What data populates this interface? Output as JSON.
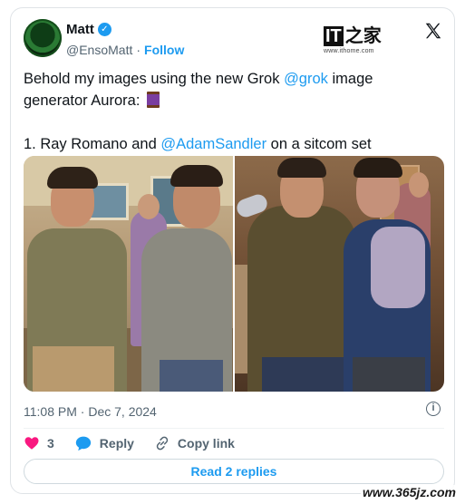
{
  "author": {
    "name": "Matt",
    "handle": "@EnsoMatt",
    "separator": "·",
    "follow_label": "Follow"
  },
  "ithome": {
    "logo_latin": "IT",
    "logo_chinese": "之家",
    "url": "www.ithome.com"
  },
  "tweet": {
    "line1_pre": "Behold my images using the new Grok ",
    "line1_mention": "@grok",
    "line1_post": " image generator Aurora: ",
    "line2_pre": "1. Ray Romano and ",
    "line2_mention": "@AdamSandler",
    "line2_post": " on a sitcom set"
  },
  "meta": {
    "time": "11:08 PM",
    "separator": "·",
    "date": "Dec 7, 2024"
  },
  "actions": {
    "likes": "3",
    "reply_label": "Reply",
    "copy_link_label": "Copy link"
  },
  "read_replies_label": "Read 2 replies",
  "watermark": "www.365jz.com",
  "icons": [
    "verified-badge-icon",
    "x-logo-icon",
    "spool-emoji-icon",
    "info-icon",
    "heart-icon",
    "reply-bubble-icon",
    "link-icon"
  ],
  "colors": {
    "accent": "#1d9bf0",
    "like": "#f91880",
    "muted": "#536471",
    "text": "#0f1419"
  }
}
